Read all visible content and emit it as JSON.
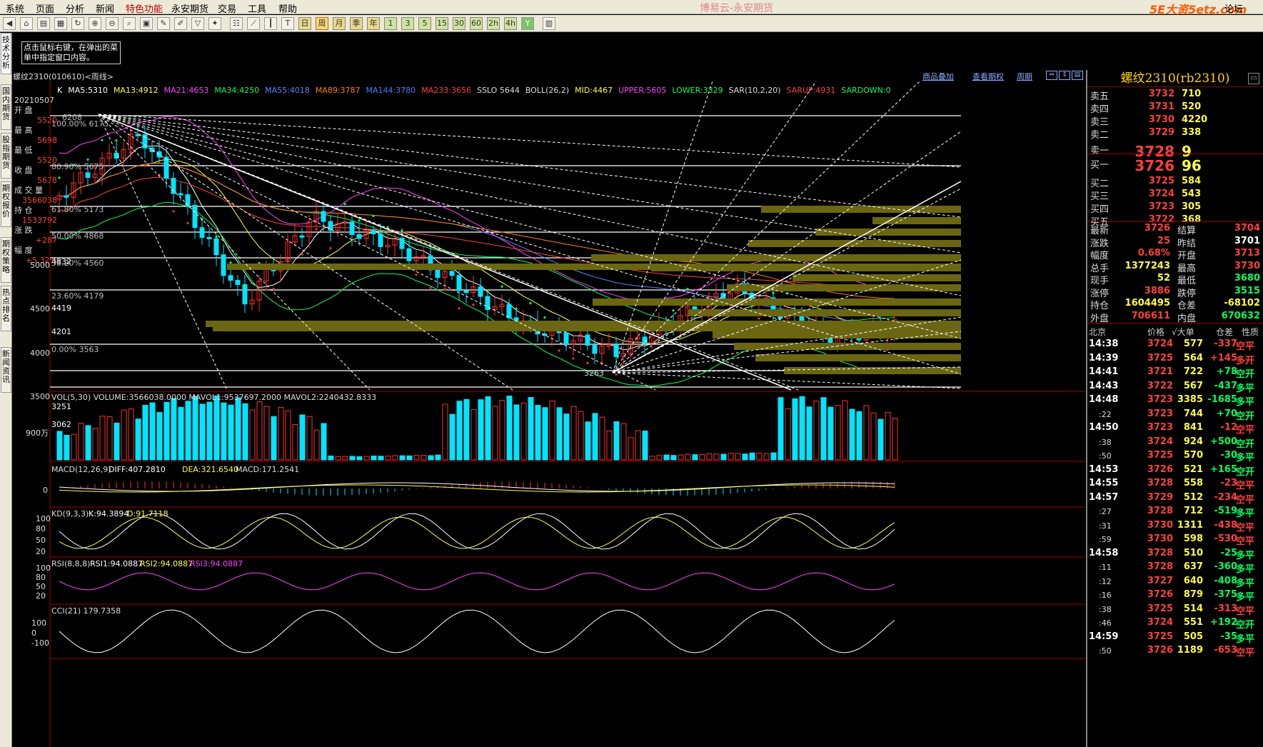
{
  "menu": [
    "系统",
    "页面",
    "分析",
    "新闻",
    "特色功能",
    "永安期货",
    "交易",
    "工具",
    "帮助"
  ],
  "app_title": "博易云-永安期货",
  "logo": "5E大资5etz.com",
  "forum": "论坛",
  "toolbar_periods": [
    "周",
    "月",
    "季",
    "年",
    "1",
    "3",
    "5",
    "15",
    "30",
    "60",
    "2h",
    "4h"
  ],
  "left_tabs": [
    "技术分析",
    "国内期货",
    "股指期货",
    "期权报价",
    "期权策略",
    "热点排名",
    "新闻资讯"
  ],
  "hint_text": "点击鼠标右键，在弹出的菜单中指定窗口内容。",
  "chart": {
    "title": "螺纹2310(010610)<周线>",
    "links": [
      "商品叠加",
      "查看期权",
      "周期"
    ],
    "ma_legend": [
      {
        "text": "K",
        "color": "#ffffff"
      },
      {
        "text": "MA5:5310",
        "color": "#ffffff"
      },
      {
        "text": "MA13:4912",
        "color": "#ffff40"
      },
      {
        "text": "MA21:4653",
        "color": "#ff40ff"
      },
      {
        "text": "MA34:4250",
        "color": "#00ff60"
      },
      {
        "text": "MA55:4018",
        "color": "#6080ff"
      },
      {
        "text": "MA89:3787",
        "color": "#ff8000"
      },
      {
        "text": "MA144:3780",
        "color": "#4080ff"
      },
      {
        "text": "MA233:3656",
        "color": "#ff4040"
      },
      {
        "text": "SSLO 5644",
        "color": "#dddddd"
      },
      {
        "text": "BOLL(26,2)",
        "color": "#dddddd"
      },
      {
        "text": "MID:4467",
        "color": "#ffff40"
      },
      {
        "text": "UPPER:5605",
        "color": "#ff40ff"
      },
      {
        "text": "LOWER:3329",
        "color": "#00ff60"
      },
      {
        "text": "SAR(10,2,20)",
        "color": "#dddddd"
      },
      {
        "text": "SARUP:4931",
        "color": "#ff4040"
      },
      {
        "text": "SARDOWN:0",
        "color": "#00ff60"
      }
    ],
    "info_box": [
      {
        "label": "20210507",
        "value": ""
      },
      {
        "label": "开    盘",
        "value": "5520"
      },
      {
        "label": "最    高",
        "value": "5698"
      },
      {
        "label": "最    低",
        "value": "5520"
      },
      {
        "label": "收    盘",
        "value": "5678"
      },
      {
        "label": "成 交 量",
        "value": "3566038"
      },
      {
        "label": "持    仓",
        "value": "1533792"
      },
      {
        "label": "涨    跌",
        "value": "+287"
      },
      {
        "label": "幅    度",
        "value": "+5.32%"
      }
    ],
    "price_axis": [
      "5000",
      "4500",
      "4000",
      "3500"
    ],
    "boxed_levels": [
      "4832",
      "4419",
      "4201",
      "3251",
      "3062"
    ],
    "fib_labels": [
      "6208",
      "100.00% 6175",
      "80.90% 5675",
      "61.80% 5173",
      "50.00% 4868",
      "38.20% 4560",
      "23.60% 4179",
      "0.00% 3563"
    ],
    "low_label": "3263",
    "volume": {
      "legend": "VOL(5,30)  VOLUME:3566038.0000  MAVOL1:9537697.2000  MAVOL2:2240432.8333",
      "axis": "900万"
    },
    "macd": {
      "legend_prefix": "MACD(12,26,9)",
      "diff": "DIFF:407.2810",
      "dea": "DEA:321.6540",
      "macd": "MACD:171.2541",
      "axis": "0"
    },
    "kd": {
      "legend_prefix": "KD(9,3,3)",
      "k": "K:94.3894",
      "d": "D:91.7118",
      "axis": [
        "100",
        "80",
        "50",
        "20"
      ]
    },
    "rsi": {
      "legend_prefix": "RSI(8,8,8)",
      "r1": "RSI1:94.0887",
      "r2": "RSI2:94.0887",
      "r3": "RSI3:94.0887",
      "axis": [
        "100",
        "80",
        "50",
        "20"
      ]
    },
    "cci": {
      "legend": "CCI(21)  179.7358",
      "axis": [
        "100",
        "0",
        "-100"
      ]
    }
  },
  "quote": {
    "title": "螺纹2310(rb2310)",
    "asks": [
      {
        "label": "卖五",
        "price": "3732",
        "vol": "710"
      },
      {
        "label": "卖四",
        "price": "3731",
        "vol": "520"
      },
      {
        "label": "卖三",
        "price": "3730",
        "vol": "4220"
      },
      {
        "label": "卖二",
        "price": "3729",
        "vol": "338"
      },
      {
        "label": "卖一",
        "price": "3728",
        "vol": "9"
      }
    ],
    "bids": [
      {
        "label": "买一",
        "price": "3726",
        "vol": "96"
      },
      {
        "label": "买二",
        "price": "3725",
        "vol": "584"
      },
      {
        "label": "买三",
        "price": "3724",
        "vol": "543"
      },
      {
        "label": "买四",
        "price": "3723",
        "vol": "305"
      },
      {
        "label": "买五",
        "price": "3722",
        "vol": "368"
      }
    ],
    "stats": [
      {
        "l1": "最新",
        "v1": "3726",
        "c1": "red",
        "l2": "结算",
        "v2": "3704",
        "c2": "red"
      },
      {
        "l1": "涨跌",
        "v1": "25",
        "c1": "red",
        "l2": "昨结",
        "v2": "3701",
        "c2": "white"
      },
      {
        "l1": "幅度",
        "v1": "0.68%",
        "c1": "red",
        "l2": "开盘",
        "v2": "3713",
        "c2": "red"
      },
      {
        "l1": "总手",
        "v1": "1377243",
        "c1": "yellow",
        "l2": "最高",
        "v2": "3730",
        "c2": "red"
      },
      {
        "l1": "现手",
        "v1": "52",
        "c1": "yellow",
        "l2": "最低",
        "v2": "3680",
        "c2": "green"
      },
      {
        "l1": "涨停",
        "v1": "3886",
        "c1": "red",
        "l2": "跌停",
        "v2": "3515",
        "c2": "green"
      },
      {
        "l1": "持仓",
        "v1": "1604495",
        "c1": "yellow",
        "l2": "仓差",
        "v2": "-68102",
        "c2": "yellow"
      },
      {
        "l1": "外盘",
        "v1": "706611",
        "c1": "red",
        "l2": "内盘",
        "v2": "670632",
        "c2": "green"
      }
    ],
    "tick_header": {
      "c1": "北京",
      "c2": "价格",
      "c3": "√大单",
      "c4": "仓差",
      "c5": "性质"
    },
    "ticks": [
      {
        "t": "14:38",
        "p": "3724",
        "v": "577",
        "o": "-337",
        "n": "空平",
        "oc": "red",
        "nc": "red",
        "sec": false
      },
      {
        "t": "14:39",
        "p": "3725",
        "v": "564",
        "o": "+145",
        "n": "多开",
        "oc": "red",
        "nc": "red",
        "sec": false
      },
      {
        "t": "14:41",
        "p": "3721",
        "v": "722",
        "o": "+78",
        "n": "空开",
        "oc": "green",
        "nc": "green",
        "sec": false
      },
      {
        "t": "14:43",
        "p": "3722",
        "v": "567",
        "o": "-437",
        "n": "多平",
        "oc": "green",
        "nc": "green",
        "sec": false
      },
      {
        "t": "14:48",
        "p": "3723",
        "v": "3385",
        "o": "-1685",
        "n": "多平",
        "oc": "green",
        "nc": "green",
        "sec": false
      },
      {
        "t": ":22",
        "p": "3723",
        "v": "744",
        "o": "+70",
        "n": "空开",
        "oc": "green",
        "nc": "green",
        "sec": true
      },
      {
        "t": "14:50",
        "p": "3723",
        "v": "841",
        "o": "-12",
        "n": "空平",
        "oc": "red",
        "nc": "red",
        "sec": false
      },
      {
        "t": ":38",
        "p": "3724",
        "v": "924",
        "o": "+500",
        "n": "空开",
        "oc": "green",
        "nc": "green",
        "sec": true
      },
      {
        "t": ":50",
        "p": "3725",
        "v": "570",
        "o": "-30",
        "n": "多平",
        "oc": "green",
        "nc": "green",
        "sec": true
      },
      {
        "t": "14:53",
        "p": "3726",
        "v": "521",
        "o": "+165",
        "n": "空开",
        "oc": "green",
        "nc": "green",
        "sec": false
      },
      {
        "t": "14:55",
        "p": "3728",
        "v": "558",
        "o": "-23",
        "n": "空平",
        "oc": "red",
        "nc": "red",
        "sec": false
      },
      {
        "t": "14:57",
        "p": "3729",
        "v": "512",
        "o": "-234",
        "n": "空平",
        "oc": "red",
        "nc": "red",
        "sec": false
      },
      {
        "t": ":27",
        "p": "3728",
        "v": "712",
        "o": "-519",
        "n": "多平",
        "oc": "green",
        "nc": "green",
        "sec": true
      },
      {
        "t": ":31",
        "p": "3730",
        "v": "1311",
        "o": "-438",
        "n": "空平",
        "oc": "red",
        "nc": "red",
        "sec": true
      },
      {
        "t": ":59",
        "p": "3730",
        "v": "598",
        "o": "-530",
        "n": "空平",
        "oc": "red",
        "nc": "red",
        "sec": true
      },
      {
        "t": "14:58",
        "p": "3728",
        "v": "510",
        "o": "-25",
        "n": "多平",
        "oc": "green",
        "nc": "green",
        "sec": false
      },
      {
        "t": ":11",
        "p": "3728",
        "v": "637",
        "o": "-360",
        "n": "多平",
        "oc": "green",
        "nc": "green",
        "sec": true
      },
      {
        "t": ":12",
        "p": "3727",
        "v": "640",
        "o": "-408",
        "n": "多平",
        "oc": "green",
        "nc": "green",
        "sec": true
      },
      {
        "t": ":16",
        "p": "3726",
        "v": "879",
        "o": "-375",
        "n": "多平",
        "oc": "green",
        "nc": "green",
        "sec": true
      },
      {
        "t": ":38",
        "p": "3725",
        "v": "514",
        "o": "-313",
        "n": "空平",
        "oc": "red",
        "nc": "red",
        "sec": true
      },
      {
        "t": ":46",
        "p": "3724",
        "v": "551",
        "o": "+192",
        "n": "空开",
        "oc": "green",
        "nc": "green",
        "sec": true
      },
      {
        "t": "14:59",
        "p": "3725",
        "v": "505",
        "o": "-35",
        "n": "多平",
        "oc": "green",
        "nc": "green",
        "sec": false
      },
      {
        "t": ":50",
        "p": "3726",
        "v": "1189",
        "o": "-653",
        "n": "空平",
        "oc": "red",
        "nc": "red",
        "sec": true
      }
    ]
  }
}
